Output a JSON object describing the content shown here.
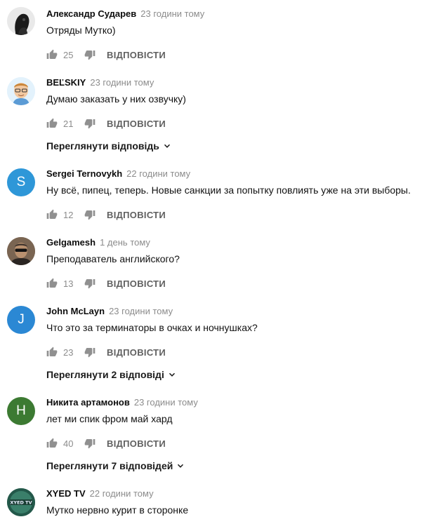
{
  "ui": {
    "reply_label": "ВІДПОВІСТИ",
    "colors": {
      "meta_text": "#8c8c8c",
      "icon": "#909090",
      "reply": "#606060"
    }
  },
  "comments": [
    {
      "author": "Александр Сударев",
      "time": "23 години тому",
      "text": "Отряды Мутко)",
      "likes": "25",
      "avatar": "dark-portrait-icon"
    },
    {
      "author": "BEĽSKIY",
      "time": "23 години тому",
      "text": "Думаю заказать у них озвучку)",
      "likes": "21",
      "avatar": "cartoon-face-icon",
      "replies": "Переглянути відповідь"
    },
    {
      "author": "Sergei Ternovykh",
      "time": "22 години тому",
      "text": "Ну всё, пипец, теперь. Новые санкции за попытку повлиять уже на эти выборы.",
      "likes": "12",
      "avatar_letter": "S",
      "avatar_color": "#2e97d8"
    },
    {
      "author": "Gelgamesh",
      "time": "1 день тому",
      "text": "Преподаватель английского?",
      "likes": "13",
      "avatar": "sunglasses-portrait-icon"
    },
    {
      "author": "John McLayn",
      "time": "23 години тому",
      "text": "Что это за терминаторы в очках и ночнушках?",
      "likes": "23",
      "avatar_letter": "J",
      "avatar_color": "#2b88d4",
      "replies": "Переглянути 2 відповіді"
    },
    {
      "author": "Никита артамонов",
      "time": "23 години тому",
      "text": "лет ми спик фром май хард",
      "likes": "40",
      "avatar_letter": "H",
      "avatar_color": "#3c7a32",
      "replies": "Переглянути 7 відповідей"
    },
    {
      "author": "XYED TV",
      "time": "22 години тому",
      "text": "Мутко нервно курит в сторонке",
      "likes": "",
      "avatar": "channel-logo-icon",
      "avatar_logo_text": "XYED TV"
    }
  ]
}
